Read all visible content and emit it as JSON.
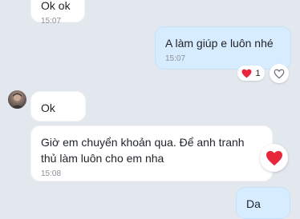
{
  "messages": [
    {
      "id": "m0",
      "text": "Ok ok",
      "time": "15:07"
    },
    {
      "id": "m1",
      "text": "A làm giúp e luôn nhé",
      "time": "15:07"
    },
    {
      "id": "m2",
      "text": "Ok",
      "time": ""
    },
    {
      "id": "m3",
      "text": "Giờ em chuyển khoản qua. Để anh tranh\nthủ làm luôn cho em nha",
      "time": "15:08"
    },
    {
      "id": "m4",
      "text": "Da",
      "time": ""
    }
  ],
  "reactions": {
    "m1_count": "1",
    "heart_color": "#e8263b"
  },
  "icons": {
    "reaction": "heart-icon",
    "react_button": "heart-outline-icon",
    "avatar": "user-avatar"
  },
  "colors": {
    "background": "#e3e8ef",
    "incoming_bubble": "#ffffff",
    "outgoing_bubble": "#d7ecff",
    "time_text": "#8a9099"
  }
}
